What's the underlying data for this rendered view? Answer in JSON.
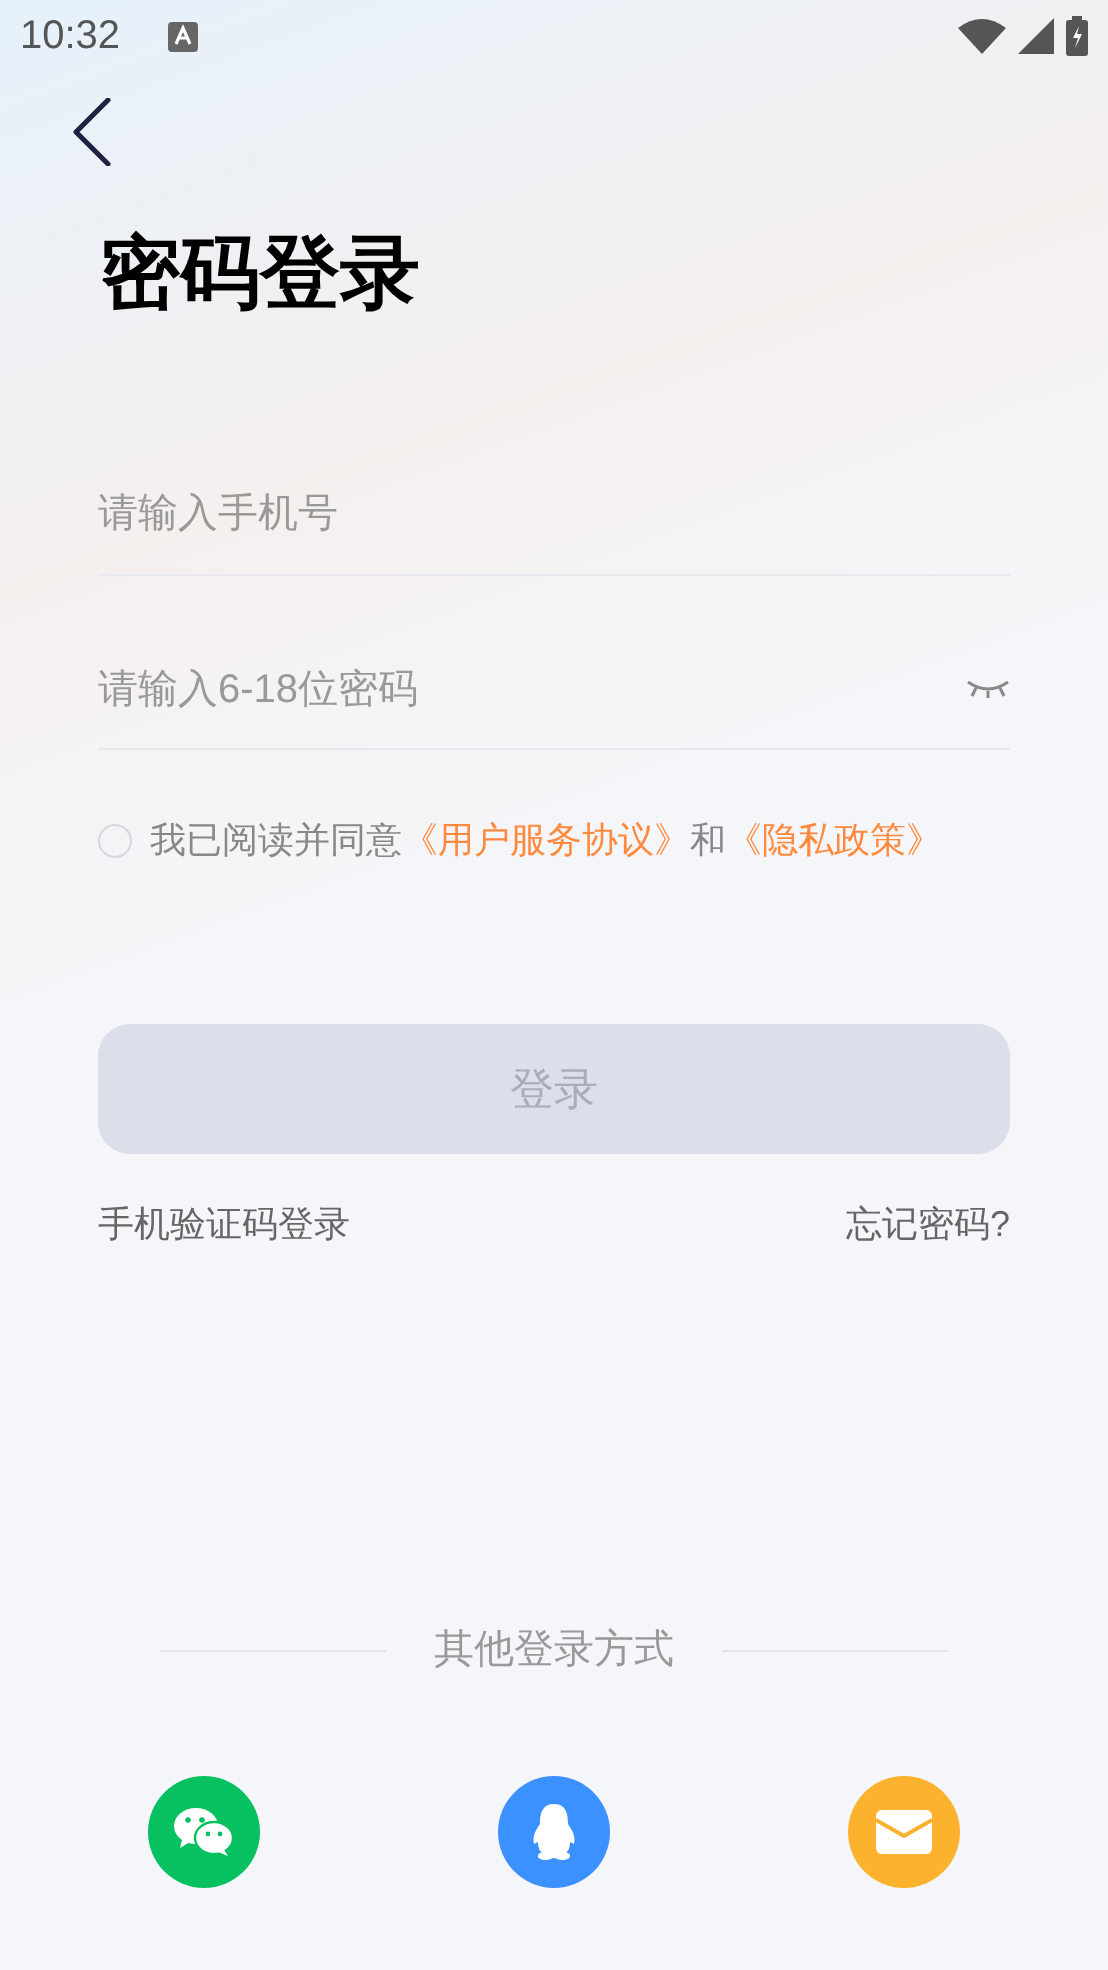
{
  "status_bar": {
    "time": "10:32"
  },
  "title": "密码登录",
  "phone_field": {
    "placeholder": "请输入手机号"
  },
  "password_field": {
    "placeholder": "请输入6-18位密码",
    "visible": false
  },
  "agreement": {
    "checked": false,
    "parts": [
      {
        "kind": "text",
        "text": "我已阅读并同意"
      },
      {
        "kind": "link",
        "text": "《用户服务协议》"
      },
      {
        "kind": "text",
        "text": "和"
      },
      {
        "kind": "link",
        "text": "《隐私政策》"
      }
    ]
  },
  "login_button": {
    "label": "登录",
    "disabled": true
  },
  "links": [
    {
      "label": "手机验证码登录"
    },
    {
      "label": "忘记密码?"
    }
  ],
  "other_login": {
    "label": "其他登录方式",
    "methods": [
      {
        "kind": "wechat",
        "color": "#07c160"
      },
      {
        "kind": "qq",
        "color": "#3a91ff"
      },
      {
        "kind": "mail",
        "color": "#fdb22d"
      }
    ]
  }
}
